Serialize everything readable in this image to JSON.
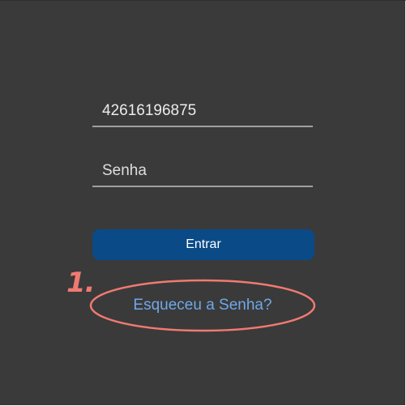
{
  "login": {
    "username_value": "42616196875",
    "password_placeholder": "Senha",
    "submit_label": "Entrar",
    "forgot_label": "Esqueceu a Senha?"
  },
  "annotation": {
    "step_label": "1.",
    "color": "#f07a72"
  },
  "colors": {
    "background": "#3a3a3a",
    "button": "#0a4a87",
    "link": "#6fa8e8",
    "underline": "#a0a0a0"
  }
}
